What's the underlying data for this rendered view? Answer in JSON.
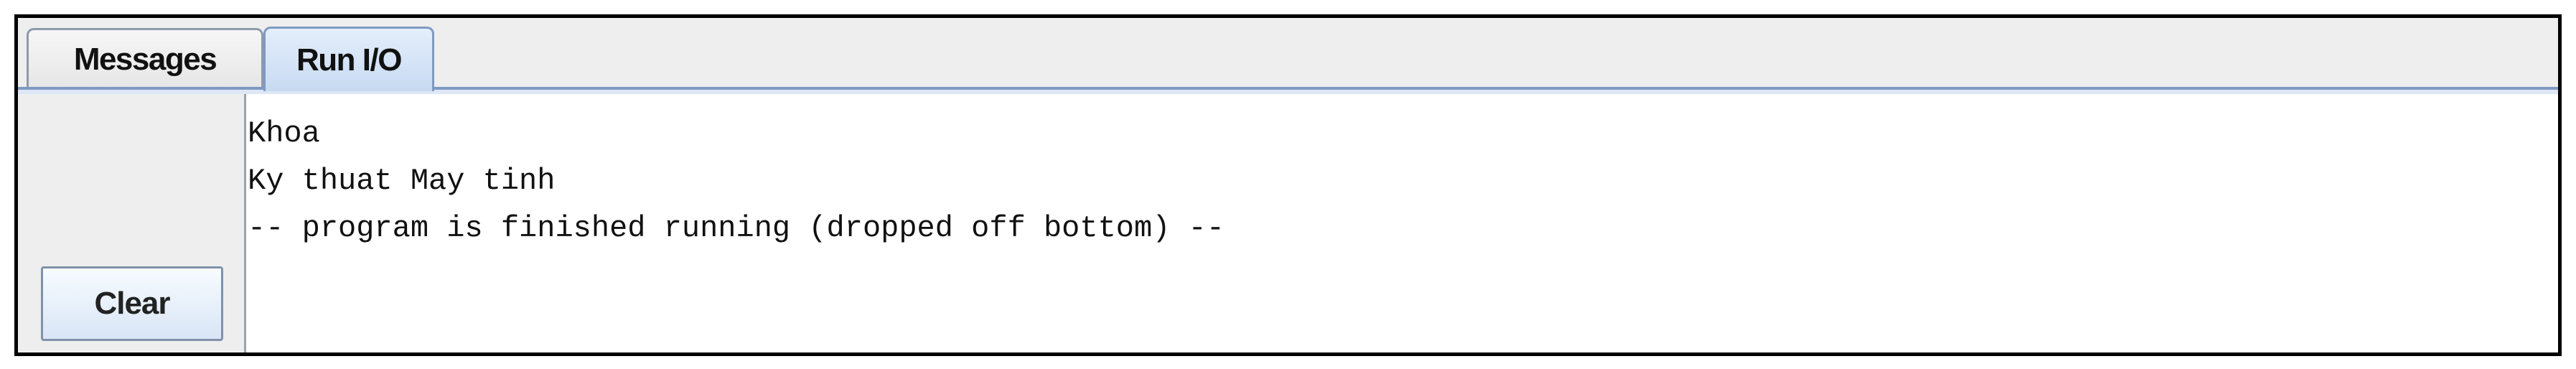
{
  "tabs": [
    {
      "label": "Messages",
      "active": false
    },
    {
      "label": "Run I/O",
      "active": true
    }
  ],
  "clear_button": {
    "label": "Clear"
  },
  "output": {
    "lines": [
      "Khoa",
      "Ky thuat May tinh",
      "-- program is finished running (dropped off bottom) --"
    ]
  },
  "colors": {
    "frame_border": "#000000",
    "panel_bg": "#eeeeee",
    "tab_active_bg": "#c7daf2",
    "tab_border": "#7f99c2",
    "output_bg": "#ffffff"
  }
}
